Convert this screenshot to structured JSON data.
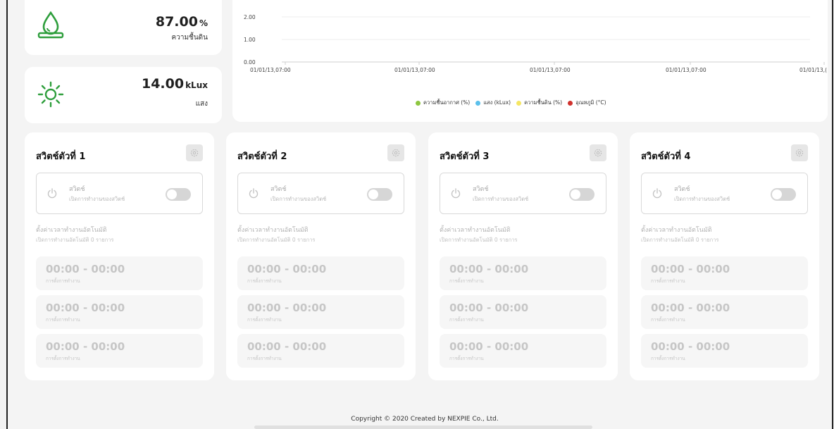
{
  "stats": {
    "soil_humidity": {
      "value": "87.00",
      "unit": "%",
      "label": "ความชื้นดิน",
      "icon": "water-drop-icon"
    },
    "light": {
      "value": "14.00",
      "unit": "kLux",
      "label": "แสง",
      "icon": "sun-icon"
    }
  },
  "chart_data": {
    "type": "line",
    "y_ticks": [
      "2.00",
      "1.00",
      "0.00"
    ],
    "ylim": [
      0,
      2
    ],
    "categories": [
      "01/01/13,07:00",
      "01/01/13,07:00",
      "01/01/13,07:00",
      "01/01/13,07:00",
      "01/01/13,("
    ],
    "series": [
      {
        "name": "ความชื้นอากาศ (%)",
        "color": "#8dc63f",
        "values": []
      },
      {
        "name": "แสง (kLux)",
        "color": "#5bc0eb",
        "values": []
      },
      {
        "name": "ความชื้นดิน (%)",
        "color": "#f5e663",
        "values": []
      },
      {
        "name": "อุณหภูมิ (°C)",
        "color": "#d0312d",
        "values": []
      }
    ]
  },
  "switches": [
    {
      "title": "สวิตช์ตัวที่ 1",
      "toggle_title": "สวิตช์",
      "toggle_sub": "เปิดการทำงานของสวิตช์",
      "schedule_title": "ตั้งค่าเวลาทำงานอัตโนมัติ",
      "schedule_sub": "เปิดการทำงานอัตโนมัติ 0 รายการ",
      "slots": [
        {
          "time": "00:00 - 00:00",
          "label": "การตั้งการทำงาน"
        },
        {
          "time": "00:00 - 00:00",
          "label": "การตั้งการทำงาน"
        },
        {
          "time": "00:00 - 00:00",
          "label": "การตั้งการทำงาน"
        }
      ]
    },
    {
      "title": "สวิตช์ตัวที่ 2",
      "toggle_title": "สวิตช์",
      "toggle_sub": "เปิดการทำงานของสวิตช์",
      "schedule_title": "ตั้งค่าเวลาทำงานอัตโนมัติ",
      "schedule_sub": "เปิดการทำงานอัตโนมัติ 0 รายการ",
      "slots": [
        {
          "time": "00:00 - 00:00",
          "label": "การตั้งการทำงาน"
        },
        {
          "time": "00:00 - 00:00",
          "label": "การตั้งการทำงาน"
        },
        {
          "time": "00:00 - 00:00",
          "label": "การตั้งการทำงาน"
        }
      ]
    },
    {
      "title": "สวิตช์ตัวที่ 3",
      "toggle_title": "สวิตช์",
      "toggle_sub": "เปิดการทำงานของสวิตช์",
      "schedule_title": "ตั้งค่าเวลาทำงานอัตโนมัติ",
      "schedule_sub": "เปิดการทำงานอัตโนมัติ 0 รายการ",
      "slots": [
        {
          "time": "00:00 - 00:00",
          "label": "การตั้งการทำงาน"
        },
        {
          "time": "00:00 - 00:00",
          "label": "การตั้งการทำงาน"
        },
        {
          "time": "00:00 - 00:00",
          "label": "การตั้งการทำงาน"
        }
      ]
    },
    {
      "title": "สวิตช์ตัวที่ 4",
      "toggle_title": "สวิตช์",
      "toggle_sub": "เปิดการทำงานของสวิตช์",
      "schedule_title": "ตั้งค่าเวลาทำงานอัตโนมัติ",
      "schedule_sub": "เปิดการทำงานอัตโนมัติ 0 รายการ",
      "slots": [
        {
          "time": "00:00 - 00:00",
          "label": "การตั้งการทำงาน"
        },
        {
          "time": "00:00 - 00:00",
          "label": "การตั้งการทำงาน"
        },
        {
          "time": "00:00 - 00:00",
          "label": "การตั้งการทำงาน"
        }
      ]
    }
  ],
  "footer": {
    "copyright": "Copyright © 2020 Created by NEXPIE Co., Ltd."
  },
  "colors": {
    "accent": "#2e9e3c",
    "page_bg": "#f4f4f4",
    "card_bg": "#ffffff"
  }
}
